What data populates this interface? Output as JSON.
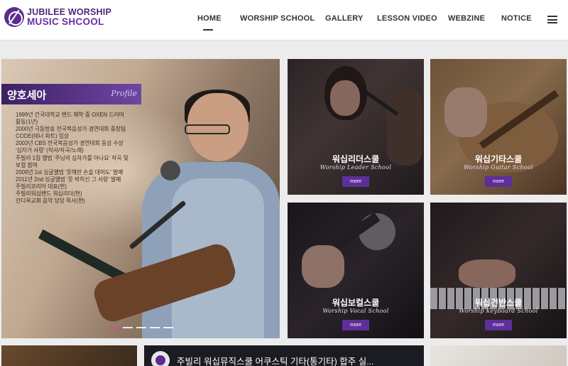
{
  "brand": {
    "line1": "JUBILEE WORSHIP",
    "line2": "MUSIC SHCOOL",
    "accent": "#5e2f9a"
  },
  "nav": {
    "items": [
      "HOME",
      "WORSHIP SCHOOL",
      "GALLERY",
      "LESSON VIDEO",
      "WEBZINE",
      "NOTICE"
    ],
    "active": "HOME",
    "menu_icon": "hamburger-menu-icon"
  },
  "hero": {
    "profile_name": "양호세아",
    "profile_tag": "Profile",
    "lines": [
      "1999년 건국대학교 밴드 재학 중 OXEN 드러머",
      "활동(1년)",
      "2000년 극동방송 전국복음성가 경연대회 중창팀",
      "CODE(테너 파트) 입상",
      "2003년 CBS 전국복음성가 경연대회 동상 수상",
      "'십자가 사랑' (작사/작곡/노래)",
      "주빌리 1집 앨범 '주님의 십자가를 아나요' 작곡 및",
      "보컬 참여",
      "2009년 1st 싱글앨범 '못해만 손을 대어도' 발매",
      "2011년 2nd 싱글앨범 '못 박히신 그 사랑' 발매",
      "주빌리코리아 대표(현)",
      "주빌리워십밴드 워십리더(현)",
      "안디옥교회 음악 담당 목사(현)"
    ],
    "slides": 5,
    "active_slide": 1
  },
  "tiles": [
    {
      "title": "워십리더스쿨",
      "subtitle": "Worship Leader School",
      "button": "more"
    },
    {
      "title": "워십기타스쿨",
      "subtitle": "Worship Guitar School",
      "button": "more"
    },
    {
      "title": "워십보컬스쿨",
      "subtitle": "Worship Vocal School",
      "button": "more"
    },
    {
      "title": "워십건반스쿨",
      "subtitle": "Worship Keyboard School",
      "button": "more"
    }
  ],
  "video": {
    "title": "주빌리 워십뮤직스쿨 어쿠스틱 기타(통기타) 합주 실..."
  }
}
